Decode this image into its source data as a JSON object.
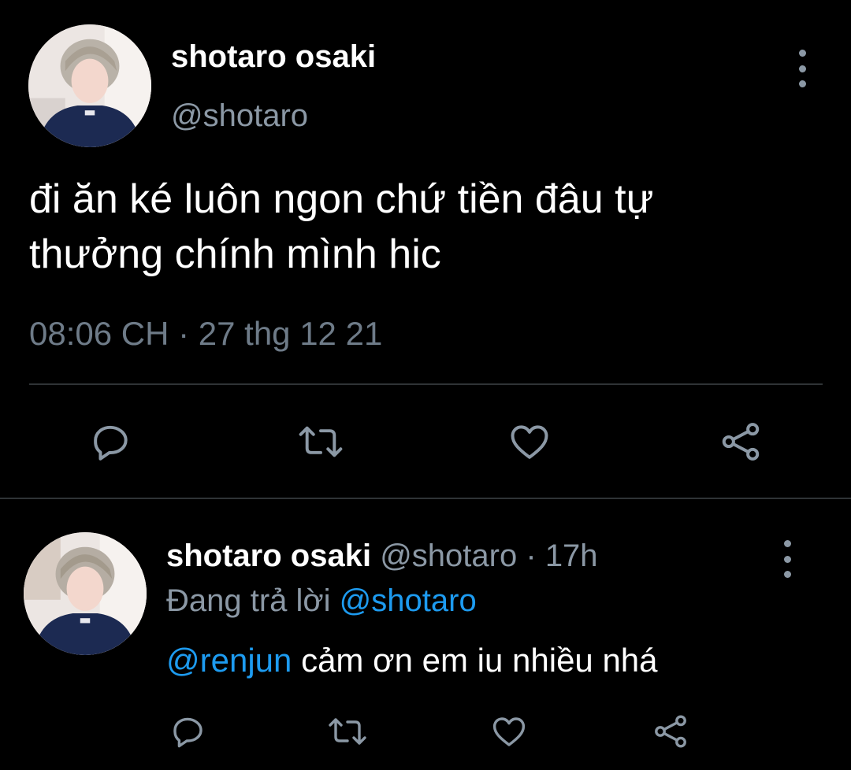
{
  "main_tweet": {
    "author_name": "shotaro osaki",
    "author_handle": "@shotaro",
    "text": "đi ăn ké luôn ngon chứ tiền đâu tự\nthưởng chính mình hic",
    "timestamp": "08:06 CH · 27 thg 12 21",
    "actions": [
      "reply-icon",
      "retweet-icon",
      "like-icon",
      "share-icon"
    ]
  },
  "reply_tweet": {
    "author_name": "shotaro osaki",
    "author_handle": "@shotaro",
    "separator": "·",
    "time_ago": "17h",
    "replying_to_label": "Đang trả lời",
    "replying_to_handle": "@shotaro",
    "mention": "@renjun",
    "text": "cảm ơn em iu nhiều nhá",
    "actions": [
      "reply-icon",
      "retweet-icon",
      "like-icon",
      "share-icon"
    ]
  },
  "colors": {
    "background": "#000000",
    "primary_text": "#ffffff",
    "secondary_text": "#8b98a5",
    "accent": "#1d9bf0",
    "divider": "#2f3336"
  }
}
